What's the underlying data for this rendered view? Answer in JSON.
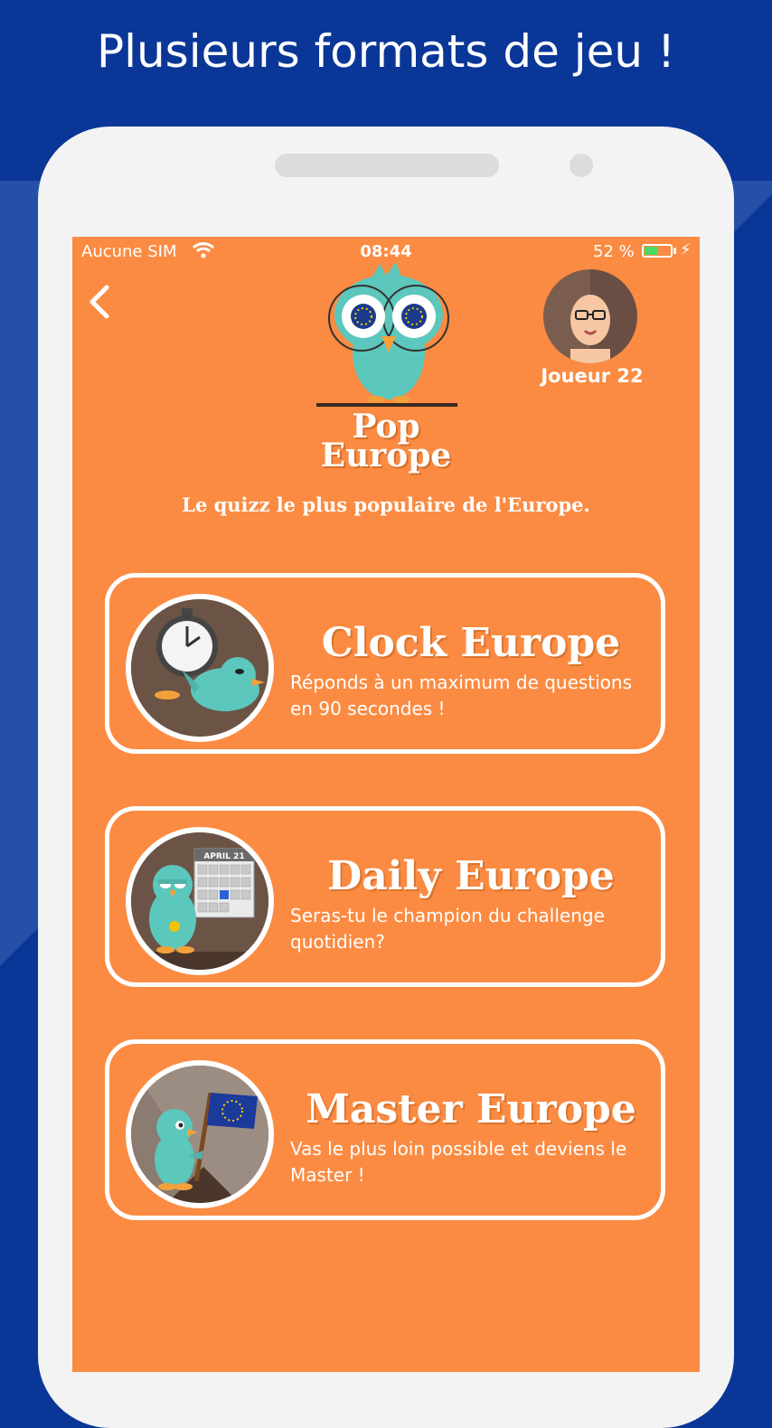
{
  "headline": "Plusieurs formats de jeu !",
  "status_bar": {
    "carrier": "Aucune SIM",
    "time": "08:44",
    "battery_text": "52 %",
    "battery_level": 0.52,
    "icons": [
      "wifi-icon",
      "battery-icon",
      "charging-bolt-icon"
    ]
  },
  "header": {
    "back_icon": "chevron-left-icon",
    "logo_line1": "Pop",
    "logo_line2": "Europe",
    "player_name": "Joueur 22"
  },
  "tagline": "Le quizz le plus populaire de l'Europe.",
  "modes": [
    {
      "title": "Clock Europe",
      "description": "Réponds à un maximum de questions en 90 secondes !",
      "icon": "stopwatch-bird-icon"
    },
    {
      "title": "Daily Europe",
      "description": "Seras-tu le champion du challenge quotidien?",
      "icon": "calendar-bird-icon",
      "calendar_label": "APRIL 21"
    },
    {
      "title": "Master Europe",
      "description": "Vas le plus loin possible et deviens le Master !",
      "icon": "flag-bird-icon"
    }
  ],
  "colors": {
    "background": "#0a3797",
    "screen": "#fb8b42",
    "bird": "#5cc7bc",
    "card_border": "#ffffff",
    "battery_fill": "#4cd964"
  }
}
